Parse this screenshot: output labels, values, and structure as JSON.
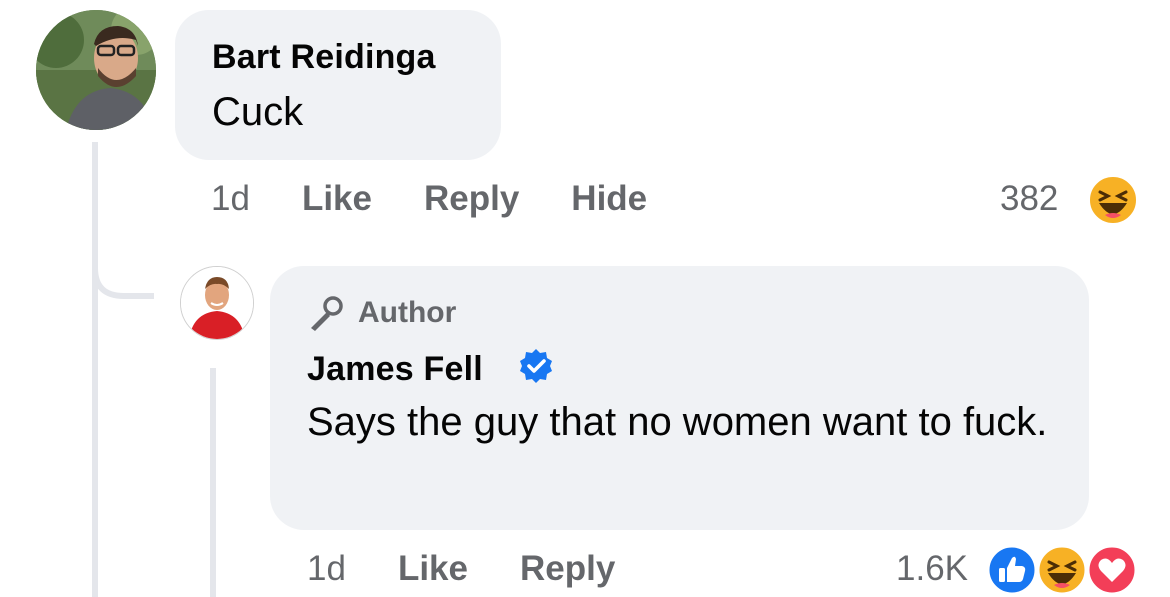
{
  "comments": [
    {
      "author": "Bart Reidinga",
      "text": "Cuck",
      "time": "1d",
      "actions": [
        "Like",
        "Reply",
        "Hide"
      ],
      "reaction_count": "382",
      "reactions": [
        "haha-icon"
      ]
    },
    {
      "badge": "Author",
      "author": "James Fell",
      "verified": true,
      "text": "Says the guy that no women want to fuck.",
      "time": "1d",
      "actions": [
        "Like",
        "Reply"
      ],
      "reaction_count": "1.6K",
      "reactions": [
        "like-icon",
        "haha-icon",
        "love-icon"
      ]
    }
  ],
  "colors": {
    "bubble": "#f0f2f5",
    "meta_text": "#65676b",
    "like_blue": "#1877f2",
    "love_red": "#f33e58",
    "haha_yellow": "#f7b125",
    "verified_blue": "#1877f2"
  }
}
